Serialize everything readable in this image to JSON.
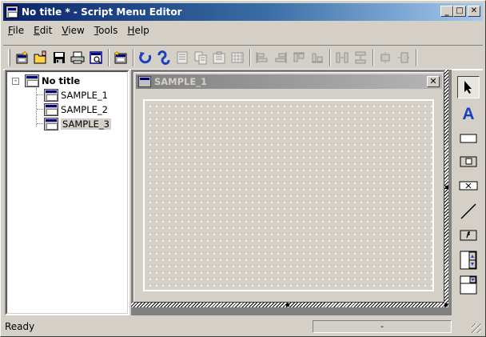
{
  "window": {
    "title": "No title * - Script Menu Editor",
    "minimize_glyph": "_",
    "maximize_glyph": "□",
    "close_glyph": "✕"
  },
  "menu": [
    {
      "key": "F",
      "rest": "ile"
    },
    {
      "key": "E",
      "rest": "dit"
    },
    {
      "key": "V",
      "rest": "iew"
    },
    {
      "key": "T",
      "rest": "ools"
    },
    {
      "key": "H",
      "rest": "elp"
    }
  ],
  "toolbar": {
    "icons": [
      "new-menu-icon",
      "open-icon",
      "save-icon",
      "print-icon",
      "preview-icon",
      "new-item-icon",
      "undo-icon",
      "redo-icon",
      "item-prop-icon",
      "copy-icon",
      "paste-icon",
      "grid-icon",
      "align-left-icon",
      "align-right-icon",
      "align-top-icon",
      "align-bottom-icon",
      "space-horiz-icon",
      "space-vert-icon",
      "center-horiz-icon",
      "center-vert-icon"
    ]
  },
  "tree": {
    "expander": "-",
    "root": "No title",
    "children": [
      "SAMPLE_1",
      "SAMPLE_2",
      "SAMPLE_3"
    ]
  },
  "form": {
    "title": "SAMPLE_1",
    "close_glyph": "✕"
  },
  "toolbox": {
    "tools": [
      "pointer-icon",
      "text-tool-icon",
      "button-tool-icon",
      "frame-tool-icon",
      "label-tool-icon",
      "line-tool-icon",
      "picture-tool-icon",
      "spin-tool-icon",
      "combo-tool-icon"
    ],
    "text_glyph": "A"
  },
  "status": {
    "text": "Ready",
    "panel": "-"
  },
  "colors": {
    "titlebar_active": "#0a246a",
    "titlebar_gradient_end": "#a6caf0",
    "face": "#d4d0c8",
    "inactive_caption": "#808080",
    "icon_blue": "#1a3fbf"
  }
}
